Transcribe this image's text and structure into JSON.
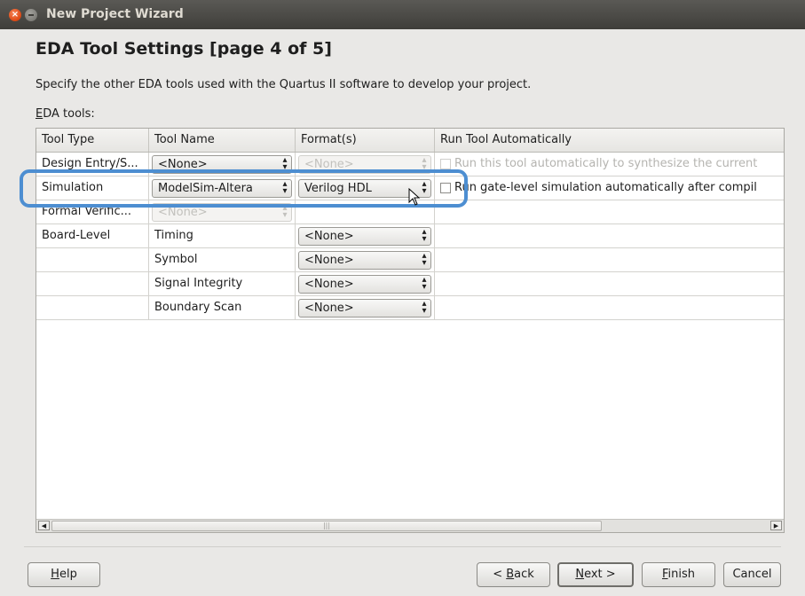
{
  "window": {
    "title": "New Project Wizard"
  },
  "page": {
    "heading": "EDA Tool Settings [page 4 of 5]",
    "instruction": "Specify the other EDA tools used with the Quartus II software to develop your project.",
    "eda_tools_label_mnemonic": "E",
    "eda_tools_label_rest": "DA tools:"
  },
  "table": {
    "columns": [
      "Tool Type",
      "Tool Name",
      "Format(s)",
      "Run Tool Automatically"
    ],
    "rows": [
      {
        "tool_type": "Design Entry/S...",
        "tool_name": "<None>",
        "tool_name_enabled": true,
        "format": "<None>",
        "format_enabled": false,
        "run_text": "Run this tool automatically to synthesize the current",
        "run_enabled": false
      },
      {
        "tool_type": "Simulation",
        "tool_name": "ModelSim-Altera",
        "tool_name_enabled": true,
        "format": "Verilog HDL",
        "format_enabled": true,
        "run_text": "Run gate-level simulation automatically after compil",
        "run_enabled": true
      },
      {
        "tool_type": "Formal Verific...",
        "tool_name": "<None>",
        "tool_name_enabled": false
      },
      {
        "tool_type": "Board-Level",
        "tool_name": "Timing",
        "format": "<None>"
      },
      {
        "tool_type": "",
        "tool_name": "Symbol",
        "format": "<None>"
      },
      {
        "tool_type": "",
        "tool_name": "Signal Integrity",
        "format": "<None>"
      },
      {
        "tool_type": "",
        "tool_name": "Boundary Scan",
        "format": "<None>"
      }
    ]
  },
  "buttons": {
    "help_mnemonic": "H",
    "help_rest": "elp",
    "back_prefix": "< ",
    "back_mnemonic": "B",
    "back_rest": "ack",
    "next_mnemonic": "N",
    "next_rest": "ext >",
    "finish_mnemonic": "F",
    "finish_rest": "inish",
    "cancel": "Cancel"
  },
  "colors": {
    "highlight": "#4d8ed1",
    "titlebar": "#3f3e3a",
    "close_button": "#df4b16"
  },
  "icons": {
    "close": "close-icon",
    "minimize": "minimize-icon",
    "combo_arrows": "updown-arrows-icon",
    "cursor": "mouse-pointer-icon"
  }
}
